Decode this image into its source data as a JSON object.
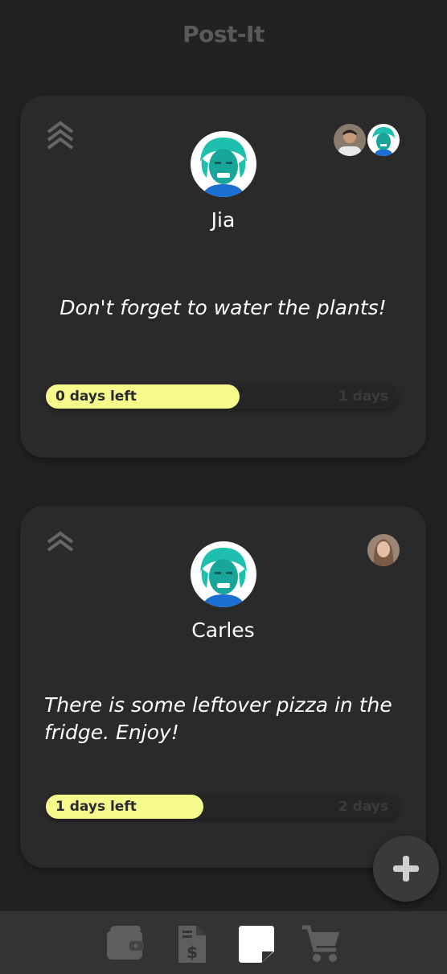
{
  "app": {
    "title": "Post-It"
  },
  "notes": [
    {
      "author": "Jia",
      "text": "Don't forget to water the plants!",
      "progress_label": "0 days left",
      "progress_total": "1 days",
      "progress_fraction": 0.55,
      "watchers": [
        "watcher-man-avatar",
        "watcher-jia-avatar"
      ]
    },
    {
      "author": "Carles",
      "text": "There is some leftover pizza in the fridge. Enjoy!",
      "progress_label": "1 days left",
      "progress_total": "2 days",
      "progress_fraction": 0.45,
      "watchers": [
        "watcher-woman-avatar"
      ]
    }
  ],
  "nav": {
    "items": [
      "wallet-icon",
      "bill-icon",
      "note-icon",
      "cart-icon"
    ],
    "active": "note-icon"
  },
  "colors": {
    "background": "#222222",
    "card": "#2a2a2a",
    "progress": "#f6f98c",
    "avatar_teal": "#1fbfb0",
    "avatar_blue": "#1a6fd0"
  }
}
